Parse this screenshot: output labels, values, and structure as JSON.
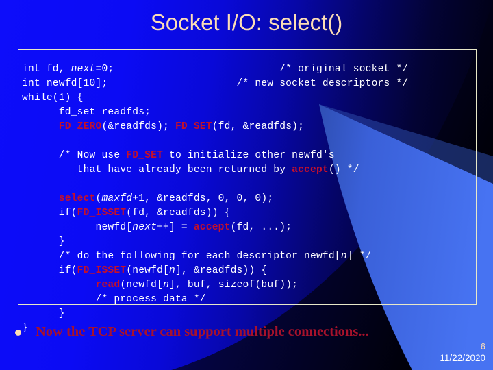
{
  "slide": {
    "title": "Socket I/O: select()",
    "page_number": "6",
    "date": "11/22/2020",
    "bullet": "Now the TCP server can support multiple connections...",
    "bullet_marker": "filled-circle-bullet"
  },
  "colors": {
    "background_left": "#0d0dfa",
    "background_right": "#000008",
    "title_text": "#fcddb5",
    "code_text": "#ffffff",
    "code_keyword": "#c4102c",
    "code_border": "#e8e8c8",
    "bullet_text": "#a8122b",
    "bullet_dot": "#fcddb5",
    "swoosh_light": "#3d68e8",
    "swoosh_dark": "#000022"
  },
  "code": {
    "lines": [
      {
        "id": "l01",
        "indent": 0,
        "text": "int fd, next=0;",
        "comment": "/* original socket */",
        "comment_col": 42
      },
      {
        "id": "l02",
        "indent": 0,
        "text": "int newfd[10];",
        "comment": "/* new socket descriptors */",
        "comment_col": 35
      },
      {
        "id": "l03",
        "indent": 0,
        "text": "while(1) {",
        "comment": "",
        "comment_col": 0
      },
      {
        "id": "l04",
        "indent": 6,
        "text": "fd_set readfds;",
        "comment": "",
        "comment_col": 0
      },
      {
        "id": "l05",
        "indent": 6,
        "text": "FD_ZERO(&readfds); FD_SET(fd, &readfds);",
        "comment": "",
        "comment_col": 0
      },
      {
        "id": "l06",
        "indent": 0,
        "text": "",
        "comment": "",
        "comment_col": 0
      },
      {
        "id": "l07",
        "indent": 6,
        "text": "/* Now use FD_SET to initialize other newfd's",
        "comment": "",
        "comment_col": 0
      },
      {
        "id": "l08",
        "indent": 9,
        "text": "that have already been returned by accept() */",
        "comment": "",
        "comment_col": 0
      },
      {
        "id": "l09",
        "indent": 0,
        "text": "",
        "comment": "",
        "comment_col": 0
      },
      {
        "id": "l10",
        "indent": 6,
        "text": "select(maxfd+1, &readfds, 0, 0, 0);",
        "comment": "",
        "comment_col": 0
      },
      {
        "id": "l11",
        "indent": 6,
        "text": "if(FD_ISSET(fd, &readfds)) {",
        "comment": "",
        "comment_col": 0
      },
      {
        "id": "l12",
        "indent": 12,
        "text": "newfd[next++] = accept(fd, ...);",
        "comment": "",
        "comment_col": 0
      },
      {
        "id": "l13",
        "indent": 6,
        "text": "}",
        "comment": "",
        "comment_col": 0
      },
      {
        "id": "l14",
        "indent": 6,
        "text": "/* do the following for each descriptor newfd[n] */",
        "comment": "",
        "comment_col": 0
      },
      {
        "id": "l15",
        "indent": 6,
        "text": "if(FD_ISSET(newfd[n], &readfds)) {",
        "comment": "",
        "comment_col": 0
      },
      {
        "id": "l16",
        "indent": 12,
        "text": "read(newfd[n], buf, sizeof(buf));",
        "comment": "",
        "comment_col": 0
      },
      {
        "id": "l17",
        "indent": 12,
        "text": "/* process data */",
        "comment": "",
        "comment_col": 0
      },
      {
        "id": "l18",
        "indent": 6,
        "text": "}",
        "comment": "",
        "comment_col": 0
      },
      {
        "id": "l19",
        "indent": 0,
        "text": "}",
        "comment": "",
        "comment_col": 0
      }
    ],
    "keywords": [
      "FD_ZERO",
      "FD_SET",
      "FD_ISSET",
      "select",
      "accept",
      "read"
    ],
    "italic_identifiers": [
      "maxfd",
      "next",
      "n"
    ]
  }
}
